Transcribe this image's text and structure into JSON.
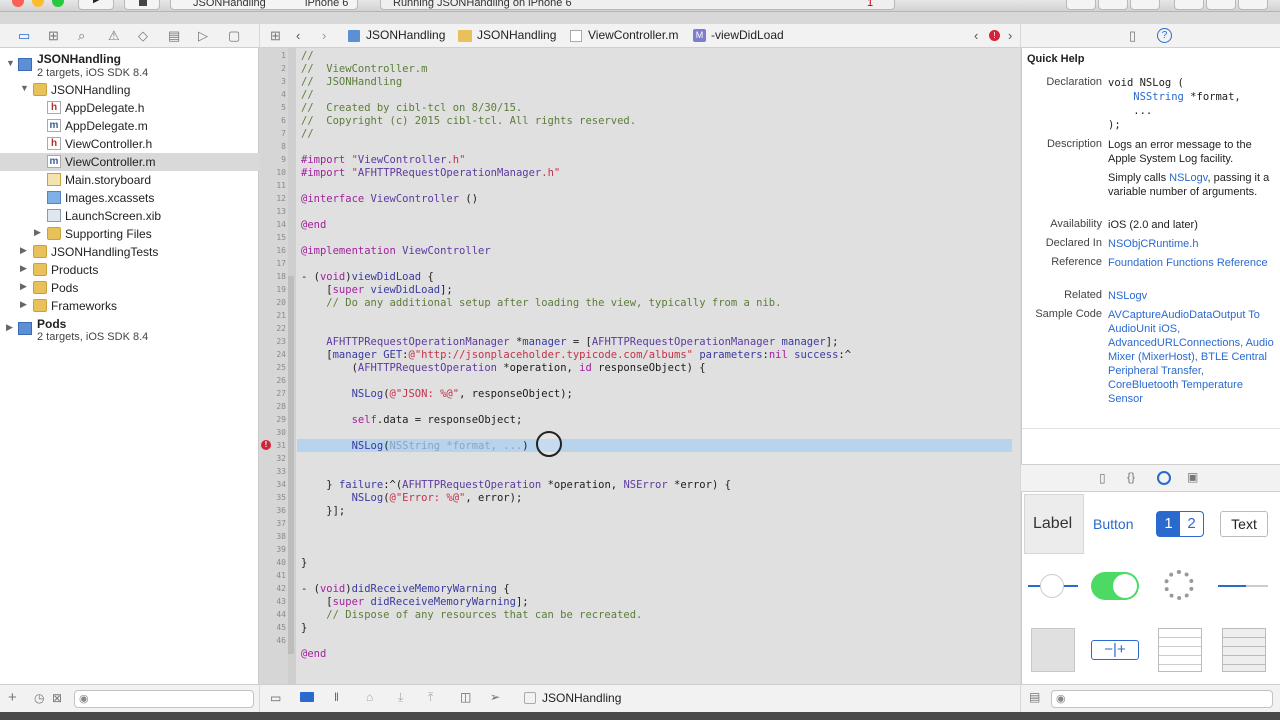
{
  "toolbar": {
    "scheme": "JSONHandling",
    "device": "iPhone 6",
    "status": "Running JSONHandling on iPhone 6",
    "issue_count": "1"
  },
  "navigator": {
    "project": {
      "name": "JSONHandling",
      "detail": "2 targets, iOS SDK 8.4"
    },
    "items": [
      {
        "label": "JSONHandling"
      },
      {
        "label": "AppDelegate.h"
      },
      {
        "label": "AppDelegate.m"
      },
      {
        "label": "ViewController.h"
      },
      {
        "label": "ViewController.m"
      },
      {
        "label": "Main.storyboard"
      },
      {
        "label": "Images.xcassets"
      },
      {
        "label": "LaunchScreen.xib"
      },
      {
        "label": "Supporting Files"
      },
      {
        "label": "JSONHandlingTests"
      },
      {
        "label": "Products"
      },
      {
        "label": "Pods"
      },
      {
        "label": "Frameworks"
      }
    ],
    "pods": {
      "name": "Pods",
      "detail": "2 targets, iOS SDK 8.4"
    }
  },
  "jumpbar": {
    "crumbs": [
      "JSONHandling",
      "JSONHandling",
      "ViewController.m",
      "-viewDidLoad"
    ]
  },
  "code": {
    "line_numbers": [
      "1",
      "2",
      "3",
      "4",
      "5",
      "6",
      "7",
      "8",
      "9",
      "10",
      "11",
      "12",
      "13",
      "14",
      "15",
      "16",
      "17",
      "18",
      "19",
      "20",
      "21",
      "22",
      "23",
      "24",
      "25",
      "26",
      "27",
      "28",
      "29",
      "30",
      "31",
      "32",
      "33",
      "34",
      "35",
      "36",
      "37",
      "38",
      "39",
      "40",
      "41",
      "42",
      "43",
      "44",
      "45",
      "46"
    ],
    "lines": [
      "//",
      "//  ViewController.m",
      "//  JSONHandling",
      "//",
      "//  Created by cibl-tcl on 8/30/15.",
      "//  Copyright (c) 2015 cibl-tcl. All rights reserved.",
      "//",
      "",
      "#import \"ViewController.h\"",
      "#import \"AFHTTPRequestOperationManager.h\"",
      "",
      "@interface ViewController ()",
      "",
      "@end",
      "",
      "@implementation ViewController",
      "",
      "- (void)viewDidLoad {",
      "    [super viewDidLoad];",
      "    // Do any additional setup after loading the view, typically from a nib.",
      "",
      "",
      "    AFHTTPRequestOperationManager *manager = [AFHTTPRequestOperationManager manager];",
      "    [manager GET:@\"http://jsonplaceholder.typicode.com/albums\" parameters:nil success:^",
      "        (AFHTTPRequestOperation *operation, id responseObject) {",
      "",
      "        NSLog(@\"JSON: %@\", responseObject);",
      "",
      "        self.data = responseObject;",
      "",
      "        NSLog(",
      "",
      "",
      "    } failure:^(AFHTTPRequestOperation *operation, NSError *error) {",
      "        NSLog(@\"Error: %@\", error);",
      "    }];",
      "",
      "",
      "",
      "}",
      "",
      "- (void)didReceiveMemoryWarning {",
      "    [super didReceiveMemoryWarning];",
      "    // Dispose of any resources that can be recreated.",
      "}",
      "",
      "@end"
    ],
    "placeholder": "NSString *format, ...",
    "placeholder_tail": ")"
  },
  "editor_bottom": {
    "target": "JSONHandling"
  },
  "quick_help": {
    "title": "Quick Help",
    "declaration_key": "Declaration",
    "declaration": [
      "void NSLog (",
      "    NSString *format,",
      "    ...",
      ");"
    ],
    "description_key": "Description",
    "description": "Logs an error message to the Apple System Log facility.",
    "simply_calls_prefix": "Simply calls",
    "simply_calls_link": "NSLogv",
    "simply_calls_suffix": ", passing it a variable number of arguments.",
    "availability_key": "Availability",
    "availability": "iOS (2.0 and later)",
    "declared_key": "Declared In",
    "declared": "NSObjCRuntime.h",
    "reference_key": "Reference",
    "reference": "Foundation Functions Reference",
    "related_key": "Related",
    "related": "NSLogv",
    "sample_key": "Sample Code",
    "sample": "AVCaptureAudioDataOutput To AudioUnit iOS, AdvancedURLConnections, Audio Mixer (MixerHost), BTLE Central Peripheral Transfer, CoreBluetooth Temperature Sensor"
  },
  "library": {
    "label": "Label",
    "button": "Button",
    "seg1": "1",
    "seg2": "2",
    "text": "Text"
  },
  "colors": {
    "accent": "#2a6acf",
    "error": "#d0243a",
    "selection": "#b8d3ec"
  }
}
